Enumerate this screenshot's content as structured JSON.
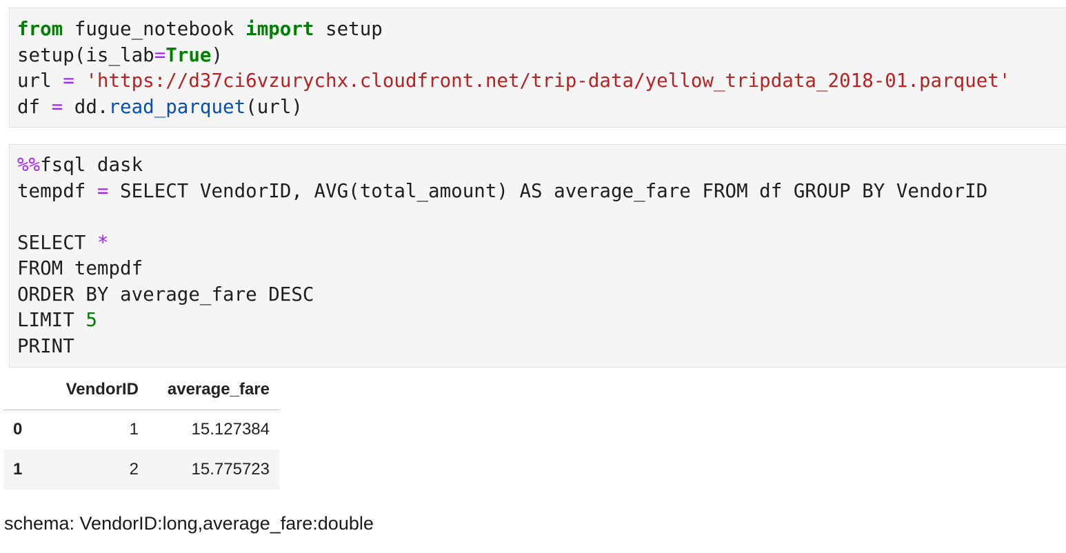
{
  "cell1": {
    "lines": [
      [
        {
          "t": "from",
          "c": "kw"
        },
        {
          "t": " fugue_notebook ",
          "c": ""
        },
        {
          "t": "import",
          "c": "kw"
        },
        {
          "t": " setup",
          "c": ""
        }
      ],
      [
        {
          "t": "setup(is_lab",
          "c": ""
        },
        {
          "t": "=",
          "c": "op"
        },
        {
          "t": "True",
          "c": "kw"
        },
        {
          "t": ")",
          "c": ""
        }
      ],
      [
        {
          "t": "url ",
          "c": ""
        },
        {
          "t": "=",
          "c": "op"
        },
        {
          "t": " ",
          "c": ""
        },
        {
          "t": "'https://d37ci6vzurychx.cloudfront.net/trip-data/yellow_tripdata_2018-01.parquet'",
          "c": "str"
        }
      ],
      [
        {
          "t": "df ",
          "c": ""
        },
        {
          "t": "=",
          "c": "op"
        },
        {
          "t": " dd.",
          "c": ""
        },
        {
          "t": "read_parquet",
          "c": "fn"
        },
        {
          "t": "(url)",
          "c": ""
        }
      ]
    ]
  },
  "cell2": {
    "lines": [
      [
        {
          "t": "%%",
          "c": "magic"
        },
        {
          "t": "fsql dask",
          "c": ""
        }
      ],
      [
        {
          "t": "tempdf ",
          "c": ""
        },
        {
          "t": "=",
          "c": "op"
        },
        {
          "t": " SELECT VendorID, AVG(total_amount) AS average_fare FROM df GROUP BY VendorID",
          "c": ""
        }
      ],
      [],
      [
        {
          "t": "SELECT ",
          "c": ""
        },
        {
          "t": "*",
          "c": "op"
        }
      ],
      [
        {
          "t": "FROM tempdf",
          "c": ""
        }
      ],
      [
        {
          "t": "ORDER BY average_fare DESC",
          "c": ""
        }
      ],
      [
        {
          "t": "LIMIT ",
          "c": ""
        },
        {
          "t": "5",
          "c": "num"
        }
      ],
      [
        {
          "t": "PRINT",
          "c": ""
        }
      ]
    ]
  },
  "table": {
    "columns": [
      "VendorID",
      "average_fare"
    ],
    "rows": [
      {
        "index": "0",
        "VendorID": "1",
        "average_fare": "15.127384"
      },
      {
        "index": "1",
        "VendorID": "2",
        "average_fare": "15.775723"
      }
    ]
  },
  "schema_text": "schema: VendorID:long,average_fare:double"
}
